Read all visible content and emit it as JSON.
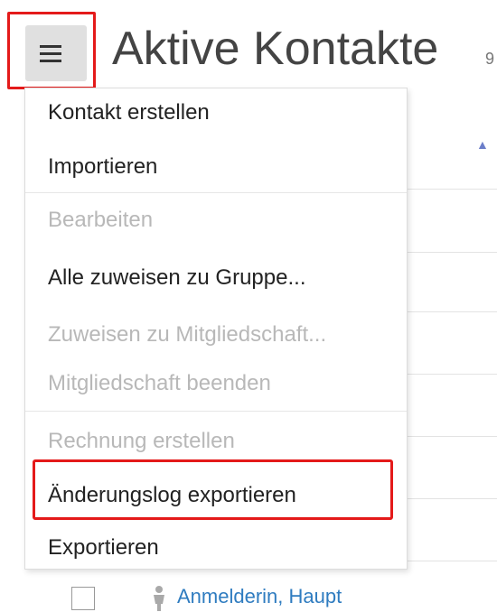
{
  "header": {
    "menu_icon": "hamburger-icon",
    "title": "Aktive Kontakte",
    "count": "9"
  },
  "list": {
    "sort_icon": "sort-asc-icon",
    "sort_color": "#6b7ec9"
  },
  "menu": {
    "items": [
      {
        "label": "Kontakt erstellen",
        "enabled": true
      },
      {
        "label": "Importieren",
        "enabled": true
      },
      {
        "label": "Bearbeiten",
        "enabled": false
      },
      {
        "label": "Alle zuweisen zu Gruppe...",
        "enabled": true
      },
      {
        "label": "Zuweisen zu Mitgliedschaft...",
        "enabled": false
      },
      {
        "label": "Mitgliedschaft beenden",
        "enabled": false
      },
      {
        "label": "Rechnung erstellen",
        "enabled": false
      },
      {
        "label": "Änderungslog exportieren",
        "enabled": true,
        "highlighted": true
      },
      {
        "label": "Exportieren",
        "enabled": true
      }
    ]
  },
  "row": {
    "contact_name": "Anmelderin, Haupt",
    "icon": "person-icon"
  },
  "colors": {
    "highlight": "#e41a1a",
    "link": "#2f7cc0",
    "disabled": "#b8b8b8"
  }
}
